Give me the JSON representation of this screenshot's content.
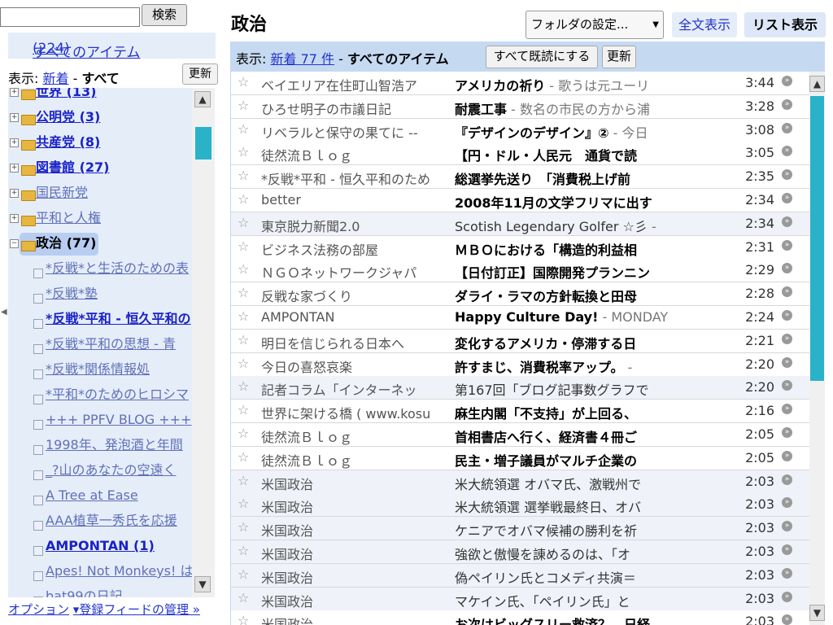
{
  "search": {
    "button": "検索",
    "value": ""
  },
  "sidebar": {
    "all_items": "すべてのアイテム",
    "all_items_count": "(224)",
    "filter_prefix": "表示:",
    "filter_new": "新着",
    "filter_sep": "-",
    "filter_all": "すべて",
    "refresh": "更新",
    "tree": [
      {
        "label": "世界 (13)",
        "type": "folder",
        "bold": true
      },
      {
        "label": "公明党 (3)",
        "type": "folder",
        "bold": true
      },
      {
        "label": "共産党 (8)",
        "type": "folder",
        "bold": true
      },
      {
        "label": "図書館 (27)",
        "type": "folder",
        "bold": true
      },
      {
        "label": "国民新党",
        "type": "folder",
        "bold": false
      },
      {
        "label": "平和と人権",
        "type": "folder",
        "bold": false
      },
      {
        "label": "政治 (77)",
        "type": "folder-open",
        "bold": true,
        "selected": true
      },
      {
        "label": "*反戦*と生活のための表",
        "type": "feed",
        "bold": false
      },
      {
        "label": "*反戦*塾",
        "type": "feed",
        "bold": false
      },
      {
        "label": "*反戦*平和 - 恒久平和の",
        "type": "feed",
        "bold": true
      },
      {
        "label": "*反戦*平和の思想 - 青",
        "type": "feed",
        "bold": false
      },
      {
        "label": "*反戦*関係情報処",
        "type": "feed",
        "bold": false
      },
      {
        "label": "*平和*のためのヒロシマ",
        "type": "feed",
        "bold": false
      },
      {
        "label": "+++ PPFV BLOG +++",
        "type": "feed",
        "bold": false
      },
      {
        "label": "1998年、発泡酒と年間",
        "type": "feed",
        "bold": false
      },
      {
        "label": "_?山のあなたの空遠く",
        "type": "feed",
        "bold": false
      },
      {
        "label": "A Tree at Ease",
        "type": "feed",
        "bold": false
      },
      {
        "label": "AAA植草一秀氏を応援",
        "type": "feed",
        "bold": false
      },
      {
        "label": "AMPONTAN (1)",
        "type": "feed",
        "bold": true
      },
      {
        "label": "Apes! Not Monkeys! は",
        "type": "feed",
        "bold": false
      },
      {
        "label": "bat99の日記",
        "type": "feed",
        "bold": false
      }
    ],
    "options": "オプション",
    "manage": "▾登録フィードの管理 »"
  },
  "header": {
    "title": "政治",
    "folder_settings": "フォルダの設定...",
    "full_view": "全文表示",
    "list_view": "リスト表示"
  },
  "list_header": {
    "prefix": "表示:",
    "new_link": "新着 77 件",
    "sep": "-",
    "all_items": "すべてのアイテム",
    "mark_all_read": "すべて既読にする",
    "refresh": "更新"
  },
  "items": [
    {
      "source": "ベイエリア在住町山智浩ア",
      "title": "アメリカの祈り",
      "snippet": " - 歌うは元ユーリ",
      "time": "3:44",
      "read": false
    },
    {
      "source": "ひろせ明子の市議日記",
      "title": "耐震工事",
      "snippet": " - 数名の市民の方から浦",
      "time": "3:28",
      "read": false
    },
    {
      "source": "リベラルと保守の果てに --",
      "title": "『デザインのデザイン』②",
      "snippet": " - 今日",
      "time": "3:08",
      "read": false
    },
    {
      "source": "徒然流Ｂｌｏｇ",
      "title": "【円・ドル・人民元　通貨で読",
      "snippet": "",
      "time": "3:05",
      "read": false
    },
    {
      "source": "*反戦*平和 - 恒久平和のため",
      "title": "総選挙先送り　「消費税上げ前",
      "snippet": "",
      "time": "2:35",
      "read": false
    },
    {
      "source": "better",
      "title": "2008年11月の文学フリマに出す",
      "snippet": "",
      "time": "2:34",
      "read": false
    },
    {
      "source": "東京脱力新聞2.0",
      "title": "Scotish Legendary Golfer ☆彡",
      "snippet": " -",
      "time": "2:34",
      "read": true
    },
    {
      "source": "ビジネス法務の部屋",
      "title": "ＭＢＯにおける「構造的利益相",
      "snippet": "",
      "time": "2:31",
      "read": false
    },
    {
      "source": "ＮＧＯネットワークジャパ",
      "title": "【日付訂正】国際開発プランニン",
      "snippet": "",
      "time": "2:29",
      "read": false
    },
    {
      "source": "反戦な家づくり",
      "title": "ダライ・ラマの方針転換と田母",
      "snippet": "",
      "time": "2:28",
      "read": false
    },
    {
      "source": "AMPONTAN",
      "title": "Happy Culture Day!",
      "snippet": " - MONDAY",
      "time": "2:24",
      "read": false
    },
    {
      "source": "明日を信じられる日本へ",
      "title": "変化するアメリカ・停滞する日",
      "snippet": "",
      "time": "2:21",
      "read": false
    },
    {
      "source": "今日の喜怒哀楽",
      "title": "許すまじ、消費税率アップ。",
      "snippet": " -",
      "time": "2:20",
      "read": false
    },
    {
      "source": "記者コラム「インターネッ",
      "title": "第167回「ブログ記事数グラフで",
      "snippet": "",
      "time": "2:20",
      "read": true
    },
    {
      "source": "世界に架ける橋 ( www.kosu",
      "title": "麻生内閣「不支持」が上回る、",
      "snippet": "",
      "time": "2:16",
      "read": false
    },
    {
      "source": "徒然流Ｂｌｏｇ",
      "title": "首相書店へ行く、経済書４冊ご",
      "snippet": "",
      "time": "2:05",
      "read": false
    },
    {
      "source": "徒然流Ｂｌｏｇ",
      "title": "民主・増子議員がマルチ企業の",
      "snippet": "",
      "time": "2:05",
      "read": false
    },
    {
      "source": "米国政治",
      "title": "米大統領選 オバマ氏、激戦州で",
      "snippet": "",
      "time": "2:03",
      "read": true
    },
    {
      "source": "米国政治",
      "title": "米大統領選 選挙戦最終日、オバ",
      "snippet": "",
      "time": "2:03",
      "read": true
    },
    {
      "source": "米国政治",
      "title": "ケニアでオバマ候補の勝利を祈",
      "snippet": "",
      "time": "2:03",
      "read": true
    },
    {
      "source": "米国政治",
      "title": "強欲と傲慢を諌めるのは、「オ",
      "snippet": "",
      "time": "2:03",
      "read": true
    },
    {
      "source": "米国政治",
      "title": "偽ペイリン氏とコメディ共演＝",
      "snippet": "",
      "time": "2:03",
      "read": true
    },
    {
      "source": "米国政治",
      "title": "マケイン氏、「ペイリン氏」と",
      "snippet": "",
      "time": "2:03",
      "read": true
    },
    {
      "source": "米国政治",
      "title": "お次はビッグスリー救済？　日経",
      "snippet": "",
      "time": "2:03",
      "read": false
    }
  ],
  "colors": {
    "accent": "#2233cc",
    "sidebar_bg": "#e5edf9",
    "header_bg": "#c5d9f1",
    "scroll_thumb": "#2ab3c8"
  }
}
